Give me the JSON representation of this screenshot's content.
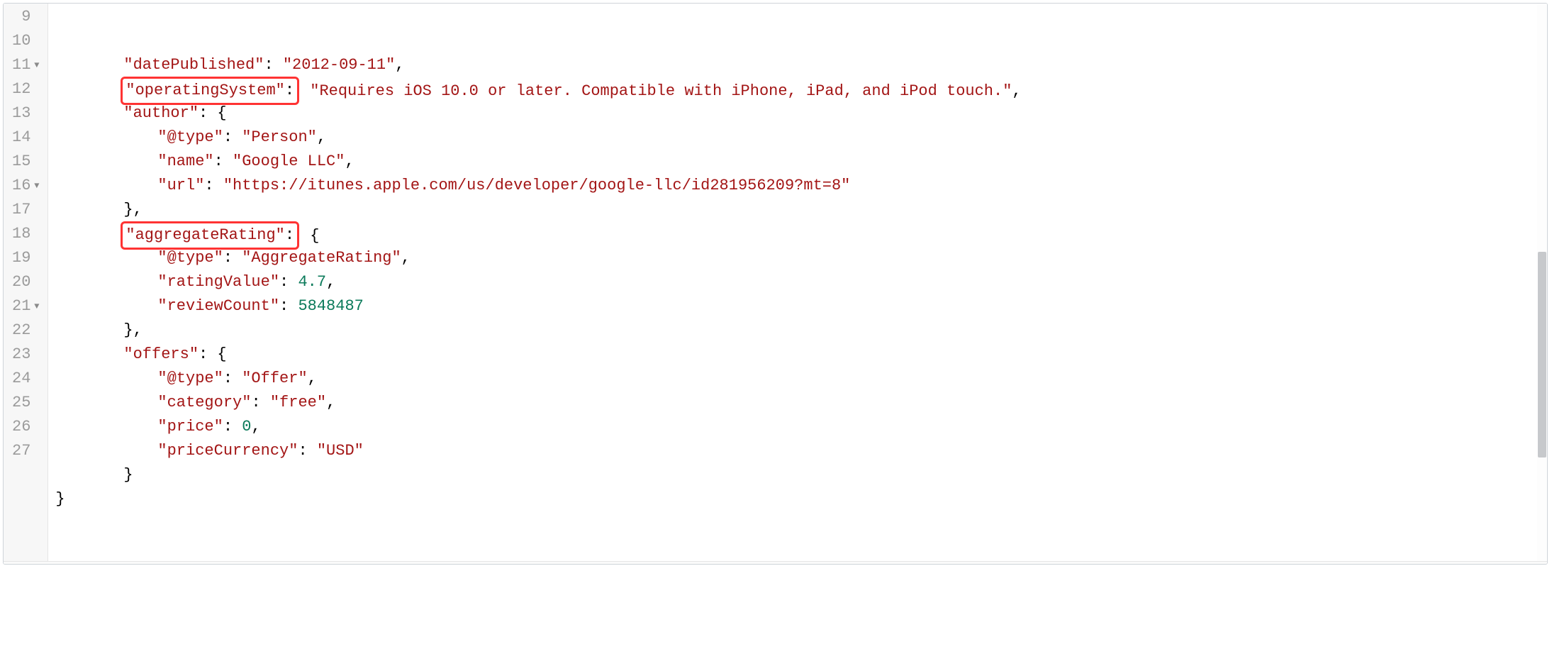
{
  "editor": {
    "startLine": 9,
    "foldableLines": [
      11,
      16,
      21
    ],
    "lines": [
      {
        "n": 9,
        "indent": 2,
        "tokens": [
          {
            "t": "\"datePublished\"",
            "c": "str"
          },
          {
            "t": ": ",
            "c": "punct"
          },
          {
            "t": "\"2012-09-11\"",
            "c": "str"
          },
          {
            "t": ",",
            "c": "punct"
          }
        ]
      },
      {
        "n": 10,
        "indent": 2,
        "tokens": [
          {
            "hlStart": true
          },
          {
            "t": "\"operatingSystem\"",
            "c": "str"
          },
          {
            "t": ":",
            "c": "punct"
          },
          {
            "hlEnd": true
          },
          {
            "t": " ",
            "c": "punct"
          },
          {
            "t": "\"Requires iOS 10.0 or later. Compatible with iPhone, iPad, and iPod touch.\"",
            "c": "str"
          },
          {
            "t": ",",
            "c": "punct"
          }
        ]
      },
      {
        "n": 11,
        "indent": 2,
        "fold": true,
        "tokens": [
          {
            "t": "\"author\"",
            "c": "str"
          },
          {
            "t": ": {",
            "c": "punct"
          }
        ]
      },
      {
        "n": 12,
        "indent": 3,
        "tokens": [
          {
            "t": "\"@type\"",
            "c": "str"
          },
          {
            "t": ": ",
            "c": "punct"
          },
          {
            "t": "\"Person\"",
            "c": "str"
          },
          {
            "t": ",",
            "c": "punct"
          }
        ]
      },
      {
        "n": 13,
        "indent": 3,
        "tokens": [
          {
            "t": "\"name\"",
            "c": "str"
          },
          {
            "t": ": ",
            "c": "punct"
          },
          {
            "t": "\"Google LLC\"",
            "c": "str"
          },
          {
            "t": ",",
            "c": "punct"
          }
        ]
      },
      {
        "n": 14,
        "indent": 3,
        "tokens": [
          {
            "t": "\"url\"",
            "c": "str"
          },
          {
            "t": ": ",
            "c": "punct"
          },
          {
            "t": "\"https://itunes.apple.com/us/developer/google-llc/id281956209?mt=8\"",
            "c": "str"
          }
        ]
      },
      {
        "n": 15,
        "indent": 2,
        "tokens": [
          {
            "t": "},",
            "c": "punct"
          }
        ]
      },
      {
        "n": 16,
        "indent": 2,
        "fold": true,
        "tokens": [
          {
            "hlStart": true
          },
          {
            "t": "\"aggregateRating\"",
            "c": "str"
          },
          {
            "t": ":",
            "c": "punct"
          },
          {
            "hlEnd": true
          },
          {
            "t": " {",
            "c": "punct"
          }
        ]
      },
      {
        "n": 17,
        "indent": 3,
        "tokens": [
          {
            "t": "\"@type\"",
            "c": "str"
          },
          {
            "t": ": ",
            "c": "punct"
          },
          {
            "t": "\"AggregateRating\"",
            "c": "str"
          },
          {
            "t": ",",
            "c": "punct"
          }
        ]
      },
      {
        "n": 18,
        "indent": 3,
        "tokens": [
          {
            "t": "\"ratingValue\"",
            "c": "str"
          },
          {
            "t": ": ",
            "c": "punct"
          },
          {
            "t": "4.7",
            "c": "num"
          },
          {
            "t": ",",
            "c": "punct"
          }
        ]
      },
      {
        "n": 19,
        "indent": 3,
        "tokens": [
          {
            "t": "\"reviewCount\"",
            "c": "str"
          },
          {
            "t": ": ",
            "c": "punct"
          },
          {
            "t": "5848487",
            "c": "num"
          }
        ]
      },
      {
        "n": 20,
        "indent": 2,
        "tokens": [
          {
            "t": "},",
            "c": "punct"
          }
        ]
      },
      {
        "n": 21,
        "indent": 2,
        "fold": true,
        "tokens": [
          {
            "t": "\"offers\"",
            "c": "str"
          },
          {
            "t": ": {",
            "c": "punct"
          }
        ]
      },
      {
        "n": 22,
        "indent": 3,
        "tokens": [
          {
            "t": "\"@type\"",
            "c": "str"
          },
          {
            "t": ": ",
            "c": "punct"
          },
          {
            "t": "\"Offer\"",
            "c": "str"
          },
          {
            "t": ",",
            "c": "punct"
          }
        ]
      },
      {
        "n": 23,
        "indent": 3,
        "tokens": [
          {
            "t": "\"category\"",
            "c": "str"
          },
          {
            "t": ": ",
            "c": "punct"
          },
          {
            "t": "\"free\"",
            "c": "str"
          },
          {
            "t": ",",
            "c": "punct"
          }
        ]
      },
      {
        "n": 24,
        "indent": 3,
        "tokens": [
          {
            "t": "\"price\"",
            "c": "str"
          },
          {
            "t": ": ",
            "c": "punct"
          },
          {
            "t": "0",
            "c": "num"
          },
          {
            "t": ",",
            "c": "punct"
          }
        ]
      },
      {
        "n": 25,
        "indent": 3,
        "tokens": [
          {
            "t": "\"priceCurrency\"",
            "c": "str"
          },
          {
            "t": ": ",
            "c": "punct"
          },
          {
            "t": "\"USD\"",
            "c": "str"
          }
        ]
      },
      {
        "n": 26,
        "indent": 2,
        "tokens": [
          {
            "t": "}",
            "c": "punct"
          }
        ]
      },
      {
        "n": 27,
        "indent": 0,
        "tokens": [
          {
            "t": "}",
            "c": "punct"
          }
        ]
      }
    ]
  }
}
